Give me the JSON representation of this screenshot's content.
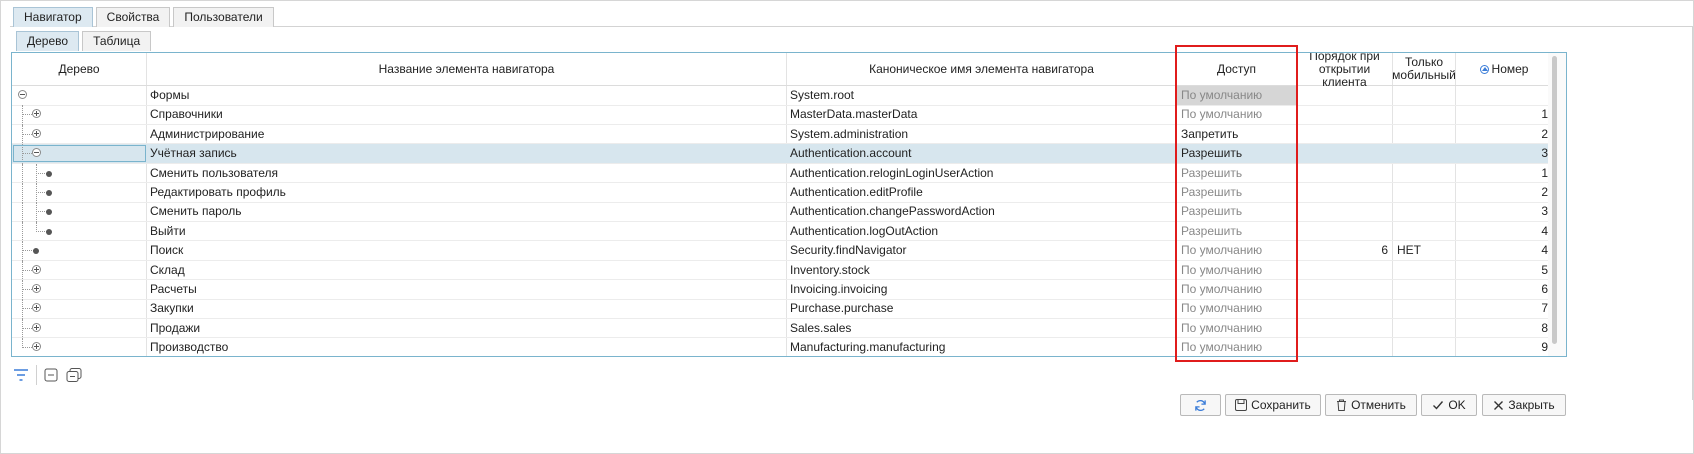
{
  "tabs_main": [
    {
      "label": "Навигатор",
      "active": true
    },
    {
      "label": "Свойства",
      "active": false
    },
    {
      "label": "Пользователи",
      "active": false
    }
  ],
  "tabs_sub": [
    {
      "label": "Дерево",
      "active": true
    },
    {
      "label": "Таблица",
      "active": false
    }
  ],
  "columns": {
    "tree": "Дерево",
    "name": "Название элемента навигатора",
    "canonical": "Каноническое имя элемента навигатора",
    "access": "Доступ",
    "order": "Порядок при открытии клиента",
    "mobile": "Только мобильный",
    "number": "Номер"
  },
  "rows": [
    {
      "level": 0,
      "node": "minus",
      "name": "Формы",
      "canonical": "System.root",
      "access": "По умолчанию",
      "access_style": "default-gray-bg",
      "order": "",
      "mobile": "",
      "number": ""
    },
    {
      "level": 1,
      "node": "plus",
      "name": "Справочники",
      "canonical": "MasterData.masterData",
      "access": "По умолчанию",
      "access_style": "gray",
      "order": "",
      "mobile": "",
      "number": "1"
    },
    {
      "level": 1,
      "node": "plus",
      "name": "Администрирование",
      "canonical": "System.administration",
      "access": "Запретить",
      "access_style": "normal",
      "order": "",
      "mobile": "",
      "number": "2"
    },
    {
      "level": 1,
      "node": "minus",
      "name": "Учётная запись",
      "canonical": "Authentication.account",
      "access": "Разрешить",
      "access_style": "normal",
      "order": "",
      "mobile": "",
      "number": "3",
      "selected": true
    },
    {
      "level": 2,
      "node": "dot",
      "name": "Сменить пользователя",
      "canonical": "Authentication.reloginLoginUserAction",
      "access": "Разрешить",
      "access_style": "gray",
      "order": "",
      "mobile": "",
      "number": "1"
    },
    {
      "level": 2,
      "node": "dot",
      "name": "Редактировать профиль",
      "canonical": "Authentication.editProfile",
      "access": "Разрешить",
      "access_style": "gray",
      "order": "",
      "mobile": "",
      "number": "2"
    },
    {
      "level": 2,
      "node": "dot",
      "name": "Сменить пароль",
      "canonical": "Authentication.changePasswordAction",
      "access": "Разрешить",
      "access_style": "gray",
      "order": "",
      "mobile": "",
      "number": "3"
    },
    {
      "level": 2,
      "node": "dot",
      "name": "Выйти",
      "canonical": "Authentication.logOutAction",
      "access": "Разрешить",
      "access_style": "gray",
      "order": "",
      "mobile": "",
      "number": "4"
    },
    {
      "level": 1,
      "node": "dot",
      "name": "Поиск",
      "canonical": "Security.findNavigator",
      "access": "По умолчанию",
      "access_style": "gray",
      "order": "6",
      "mobile": "НЕТ",
      "number": "4"
    },
    {
      "level": 1,
      "node": "plus",
      "name": "Склад",
      "canonical": "Inventory.stock",
      "access": "По умолчанию",
      "access_style": "gray",
      "order": "",
      "mobile": "",
      "number": "5"
    },
    {
      "level": 1,
      "node": "plus",
      "name": "Расчеты",
      "canonical": "Invoicing.invoicing",
      "access": "По умолчанию",
      "access_style": "gray",
      "order": "",
      "mobile": "",
      "number": "6"
    },
    {
      "level": 1,
      "node": "plus",
      "name": "Закупки",
      "canonical": "Purchase.purchase",
      "access": "По умолчанию",
      "access_style": "gray",
      "order": "",
      "mobile": "",
      "number": "7"
    },
    {
      "level": 1,
      "node": "plus",
      "name": "Продажи",
      "canonical": "Sales.sales",
      "access": "По умолчанию",
      "access_style": "gray",
      "order": "",
      "mobile": "",
      "number": "8"
    },
    {
      "level": 1,
      "node": "plus",
      "name": "Производство",
      "canonical": "Manufacturing.manufacturing",
      "access": "По умолчанию",
      "access_style": "gray",
      "order": "",
      "mobile": "",
      "number": "9"
    }
  ],
  "toolbar": {
    "filter_icon": "filter-icon",
    "collapse_icon": "collapse-all-icon",
    "expand_icon": "expand-all-icon"
  },
  "buttons": {
    "refresh_icon": "refresh-icon",
    "save": "Сохранить",
    "cancel": "Отменить",
    "ok": "OK",
    "close": "Закрыть"
  },
  "colors": {
    "accent": "#7ab4cd",
    "selected_row": "#d7e6ee",
    "highlight": "#e01c1c"
  }
}
